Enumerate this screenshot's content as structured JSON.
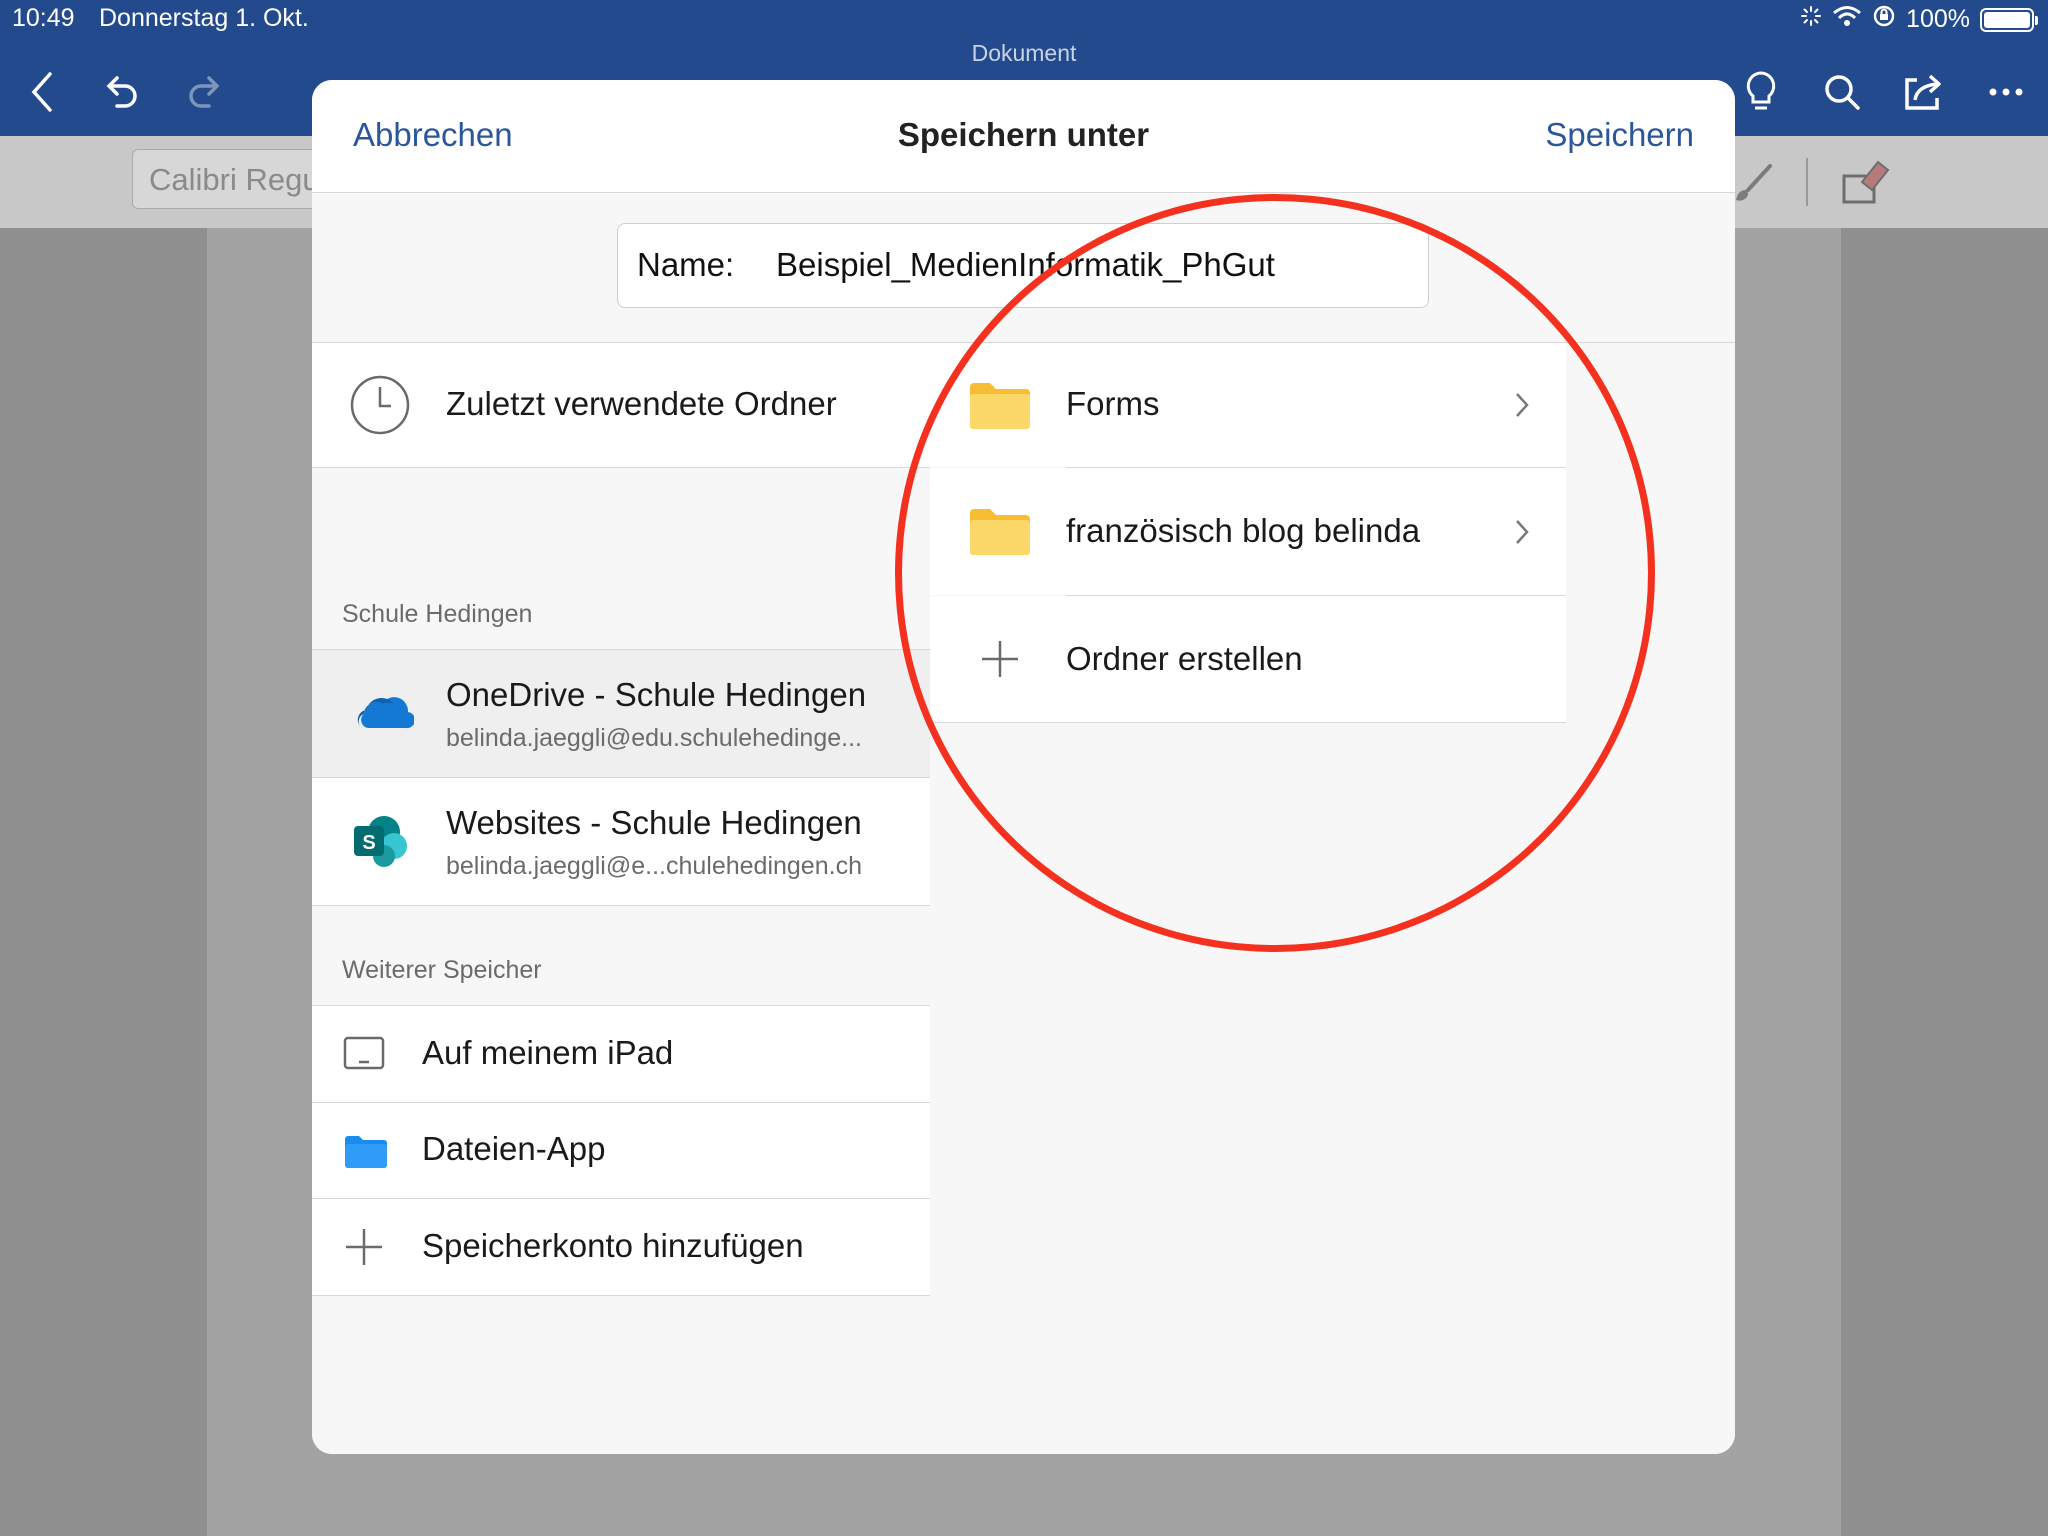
{
  "status_bar": {
    "time": "10:49",
    "date": "Donnerstag 1. Okt.",
    "battery": "100%"
  },
  "app": {
    "document_title": "Dokument",
    "font_name": "Calibri Regu"
  },
  "dialog": {
    "cancel": "Abbrechen",
    "title": "Speichern unter",
    "save": "Speichern",
    "name_label": "Name:",
    "name_value": "Beispiel_MedienInformatik_PhGut",
    "recent": "Zuletzt verwendete Ordner",
    "section_school": "Schule Hedingen",
    "onedrive": {
      "title": "OneDrive - Schule Hedingen",
      "account": "belinda.jaeggli@edu.schulehedinge..."
    },
    "websites": {
      "title": "Websites - Schule Hedingen",
      "account": "belinda.jaeggli@e...chulehedingen.ch"
    },
    "section_other": "Weiterer Speicher",
    "ipad": "Auf meinem iPad",
    "files_app": "Dateien-App",
    "add_account": "Speicherkonto hinzufügen",
    "folders": [
      {
        "name": "Forms"
      },
      {
        "name": "französisch blog belinda"
      }
    ],
    "create_folder": "Ordner erstellen"
  },
  "colors": {
    "topbar": "#224a8d",
    "accent": "#2b579a",
    "highlight_circle": "#f4311f",
    "folder": "#fcd869"
  }
}
